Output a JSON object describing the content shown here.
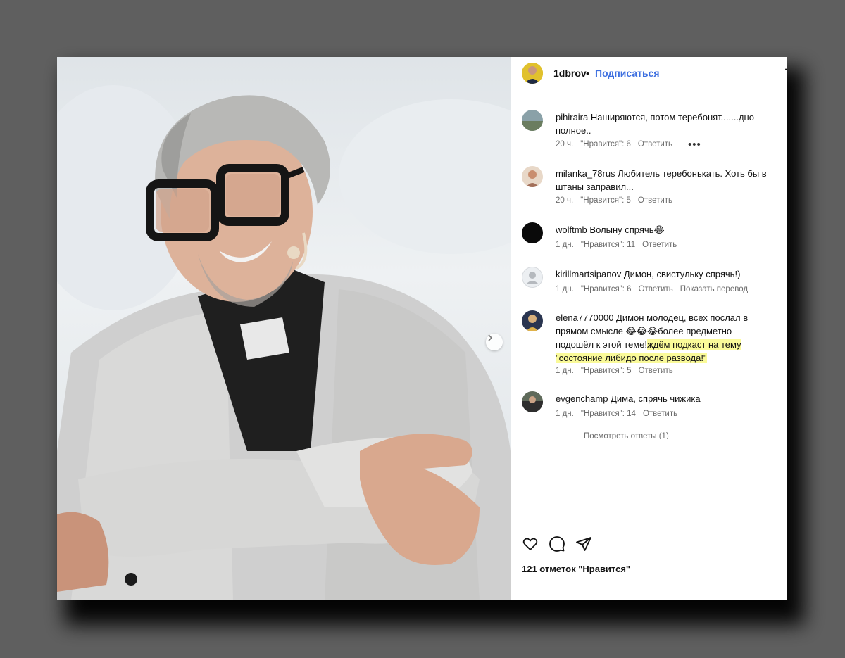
{
  "post": {
    "username": "1dbrov",
    "dot": "•",
    "follow_label": "Подписаться",
    "more": "·",
    "likes_count": "121 отметок \"Нравится\""
  },
  "comments": [
    {
      "user": "pihiraira",
      "text": "Наширяются, потом теребонят.......дно полное..",
      "time": "20 ч.",
      "likes": "\"Нравится\": 6",
      "reply": "Ответить",
      "more": "•••"
    },
    {
      "user": "milanka_78rus",
      "text": "Любитель теребонькать. Хоть бы в штаны заправил...",
      "time": "20 ч.",
      "likes": "\"Нравится\": 5",
      "reply": "Ответить"
    },
    {
      "user": "wolftmb",
      "text": "Волыну спрячь😂",
      "time": "1 дн.",
      "likes": "\"Нравится\": 11",
      "reply": "Ответить"
    },
    {
      "user": "kirillmartsipanov",
      "text": "Димон, свистульку спрячь!)",
      "time": "1 дн.",
      "likes": "\"Нравится\": 6",
      "reply": "Ответить",
      "translate": "Показать перевод"
    },
    {
      "user": "elena7770000",
      "text_plain": "Димон молодец, всех послал в прямом смысле 😂😂😂более предметно подошёл к этой теме!",
      "text_highlight_1": "ждём подкаст на тему",
      "text_highlight_2": "\"состояние либидо после развода!\"",
      "time": "1 дн.",
      "likes": "\"Нравится\": 5",
      "reply": "Ответить"
    },
    {
      "user": "evgenchamp",
      "text": "Дима, спрячь чижика",
      "time": "1 дн.",
      "likes": "\"Нравится\": 14",
      "reply": "Ответить",
      "view_replies": "Посмотреть ответы (1)"
    }
  ],
  "icons": {
    "like": "heart-icon",
    "comment": "comment-icon",
    "share": "send-icon",
    "next": "chevron-right-icon"
  },
  "colors": {
    "accent": "#3d6fe0",
    "highlight": "#fafa99"
  }
}
